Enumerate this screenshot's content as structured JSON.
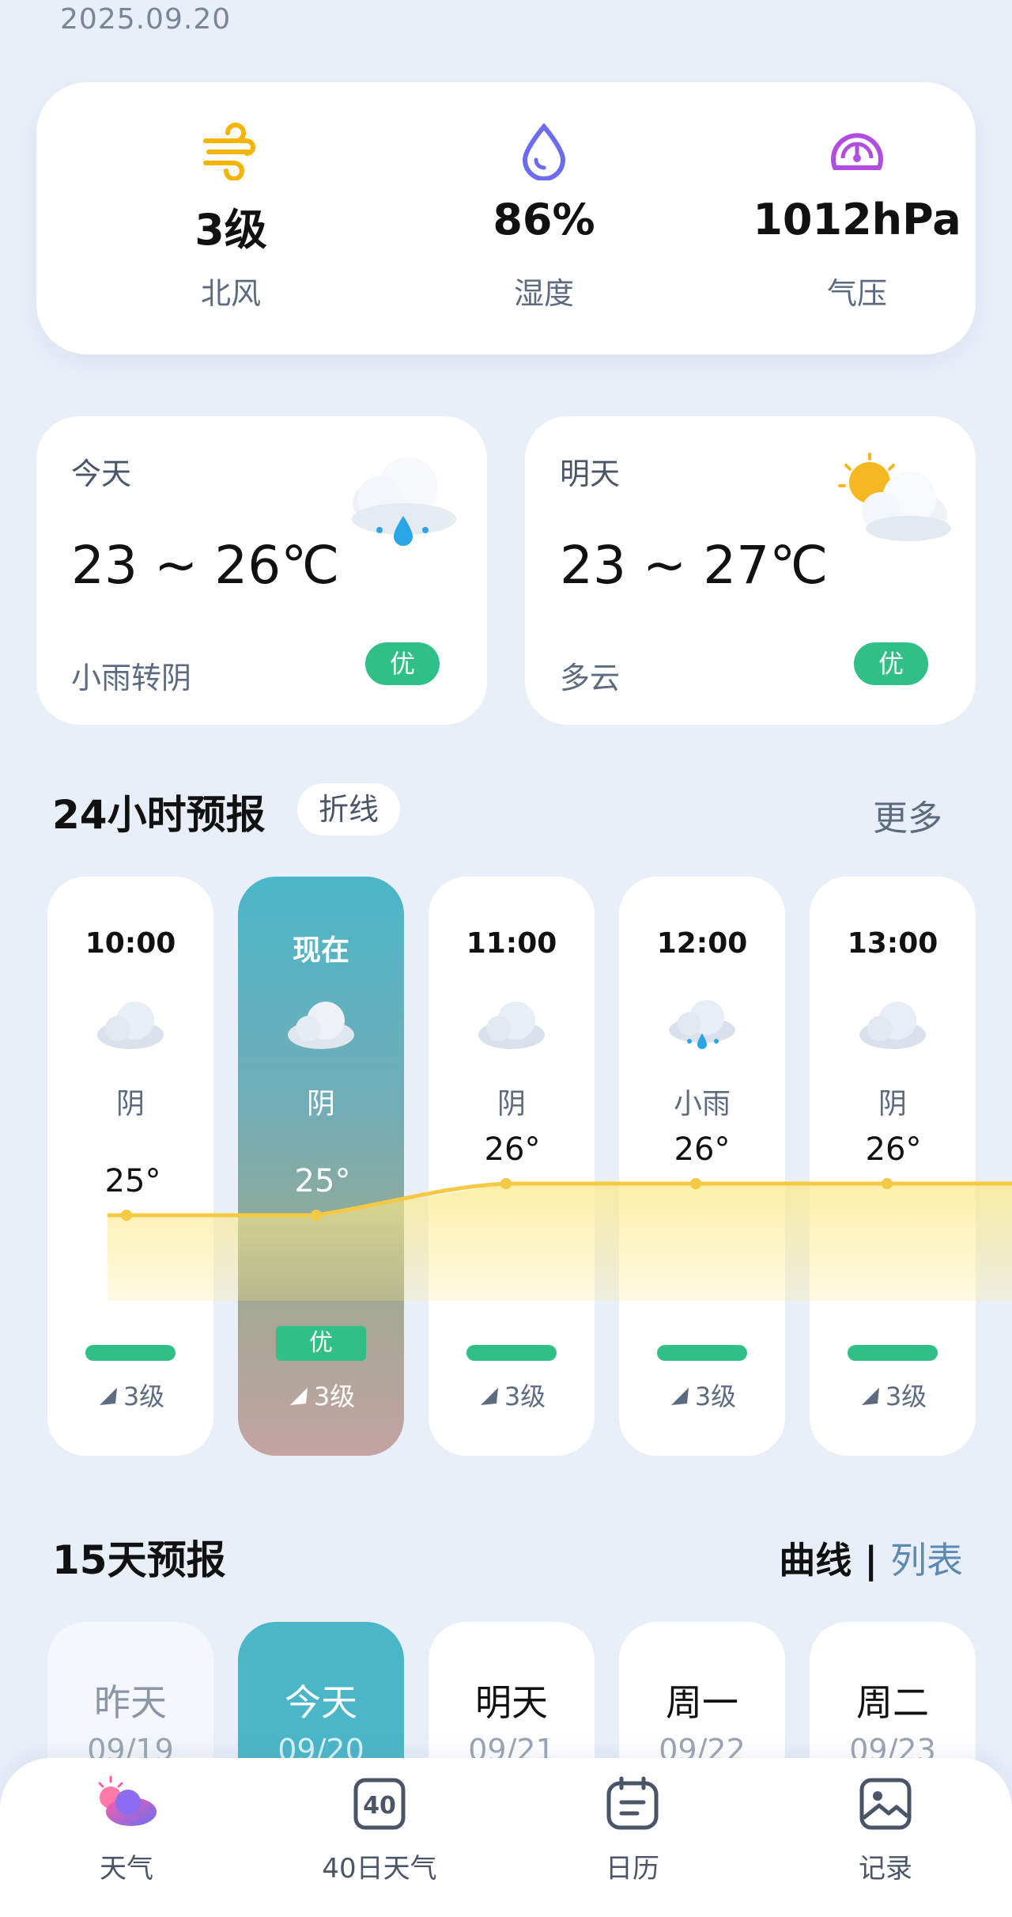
{
  "date": "2025.09.20",
  "stats": [
    {
      "icon": "wind-icon",
      "value": "3级",
      "label": "北风",
      "color": "#f5b400"
    },
    {
      "icon": "humidity-icon",
      "value": "86%",
      "label": "湿度",
      "color": "#6b6df0"
    },
    {
      "icon": "pressure-gauge-icon",
      "value": "1012hPa",
      "label": "气压",
      "color": "#b04ee0"
    }
  ],
  "today": {
    "title": "今天",
    "temp": "23 ~ 26℃",
    "desc": "小雨转阴",
    "aqi": "优",
    "icon": "light-rain-cloud-icon"
  },
  "tomorrow": {
    "title": "明天",
    "temp": "23 ~ 27℃",
    "desc": "多云",
    "aqi": "优",
    "icon": "partly-cloudy-icon"
  },
  "hourly": {
    "title": "24小时预报",
    "mode_chip": "折线",
    "more": "更多",
    "items": [
      {
        "time": "10:00",
        "cond": "阴",
        "temp": "25°",
        "wind": "3级",
        "aqi": "",
        "icon": "cloud-icon"
      },
      {
        "time": "现在",
        "cond": "阴",
        "temp": "25°",
        "wind": "3级",
        "aqi": "优",
        "icon": "cloud-icon"
      },
      {
        "time": "11:00",
        "cond": "阴",
        "temp": "26°",
        "wind": "3级",
        "aqi": "",
        "icon": "cloud-icon"
      },
      {
        "time": "12:00",
        "cond": "小雨",
        "temp": "26°",
        "wind": "3级",
        "aqi": "",
        "icon": "light-rain-cloud-icon"
      },
      {
        "time": "13:00",
        "cond": "阴",
        "temp": "26°",
        "wind": "3级",
        "aqi": "",
        "icon": "cloud-icon"
      }
    ]
  },
  "daily": {
    "title": "15天预报",
    "toggle_on": "曲线",
    "toggle_sep": "|",
    "toggle_off": "列表",
    "items": [
      {
        "name": "昨天",
        "date": "09/19"
      },
      {
        "name": "今天",
        "date": "09/20"
      },
      {
        "name": "明天",
        "date": "09/21"
      },
      {
        "name": "周一",
        "date": "09/22"
      },
      {
        "name": "周二",
        "date": "09/23"
      }
    ]
  },
  "tabs": [
    {
      "label": "天气",
      "icon": "weather-tab-icon"
    },
    {
      "label": "40日天气",
      "icon": "forty-day-calendar-icon"
    },
    {
      "label": "日历",
      "icon": "calendar-icon"
    },
    {
      "label": "记录",
      "icon": "image-record-icon"
    }
  ],
  "colors": {
    "accent": "#4ab6c8",
    "aqi_good": "#2fbf87",
    "temp_line": "#f6c944"
  }
}
